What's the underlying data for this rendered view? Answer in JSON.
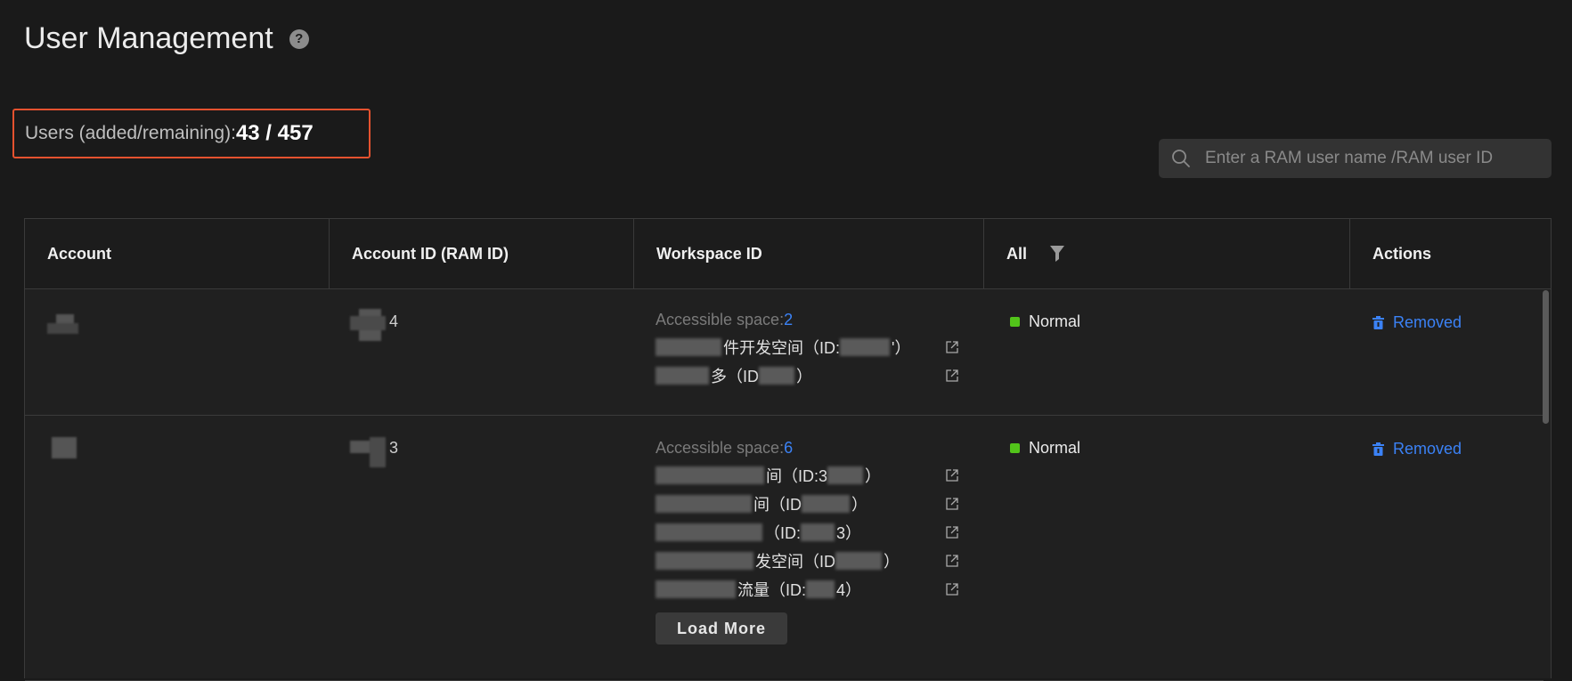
{
  "page_title": "User Management",
  "users_summary": {
    "label": "Users (added/remaining):",
    "value": "43 / 457"
  },
  "search": {
    "placeholder": "Enter a RAM user name /RAM user ID"
  },
  "table": {
    "headers": [
      "Account",
      "Account ID (RAM ID)",
      "Workspace ID",
      "All",
      "Actions"
    ],
    "rows": [
      {
        "account_id_suffix": "4",
        "accessible_label": "Accessible space:",
        "accessible_count": "2",
        "workspaces": [
          {
            "visible_text": "件开发空间（ID:",
            "tail": "'）"
          },
          {
            "visible_text": "多（ID",
            "tail": "）"
          }
        ],
        "status": "Normal",
        "action": "Removed"
      },
      {
        "account_id_suffix": "3",
        "accessible_label": "Accessible space:",
        "accessible_count": "6",
        "workspaces": [
          {
            "visible_text": "间（ID:3",
            "tail": "）"
          },
          {
            "visible_text": "间（ID",
            "tail": "）"
          },
          {
            "visible_text": "（ID:",
            "tail": "3）"
          },
          {
            "visible_text": "发空间（ID",
            "tail": "）"
          },
          {
            "visible_text": "流量（ID:",
            "tail": "4）"
          }
        ],
        "status": "Normal",
        "action": "Removed",
        "load_more": "Load More"
      }
    ]
  },
  "colors": {
    "accent": "#3b82f6",
    "status_normal": "#52c41a",
    "highlight_border": "#e5522f"
  }
}
